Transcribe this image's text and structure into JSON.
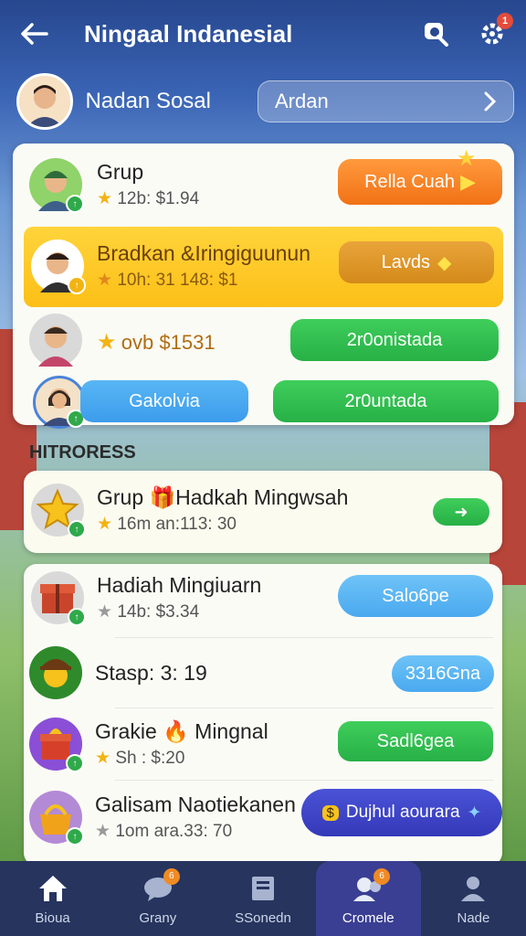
{
  "header": {
    "title": "Ningaal Indanesial",
    "notification_count": "1"
  },
  "user": {
    "name": "Nadan Sosal",
    "search_value": "Ardan"
  },
  "top_list": [
    {
      "name": "Grup",
      "meta": "12b: $1.94",
      "button": "Rella Cuah",
      "button_color": "#f27116"
    },
    {
      "name": "Bradkan &Iringiguunun",
      "meta": "10h: 31 148: $1",
      "button": "Lavds",
      "button_color": "#e29b14"
    },
    {
      "name": "",
      "meta": "ovb $1531",
      "button": "2r0onistada",
      "button_color": "#27b046"
    },
    {
      "name": "",
      "meta": "",
      "left_button": "Gakolvia",
      "button": "2r0untada",
      "button_color": "#27b046"
    }
  ],
  "section_title": "HITRORESS",
  "progress_list": [
    {
      "name": "Grup 🎁Hadkah Mingwsah",
      "meta": "16m an:113: 30"
    },
    {
      "name": "Hadiah Mingiuarn",
      "meta": "14b: $3.34",
      "button": "Salo6pe"
    },
    {
      "name": "Stasp: 3: 19",
      "meta": "",
      "button": "3316Gna"
    },
    {
      "name": "Grakie 🔥 Mingnal",
      "meta": "Sh : $:20",
      "button": "Sadl6gea"
    },
    {
      "name": "Galisam Naotiekanen",
      "meta": "1om ara.33: 70",
      "button": "Dujhul aourara"
    }
  ],
  "tabs": [
    {
      "label": "Bioua",
      "icon": "home-icon"
    },
    {
      "label": "Grany",
      "icon": "chat-icon",
      "badge": "6"
    },
    {
      "label": "SSonedn",
      "icon": "book-icon"
    },
    {
      "label": "Cromele",
      "icon": "community-icon",
      "badge": "6"
    },
    {
      "label": "Nade",
      "icon": "profile-icon"
    }
  ]
}
